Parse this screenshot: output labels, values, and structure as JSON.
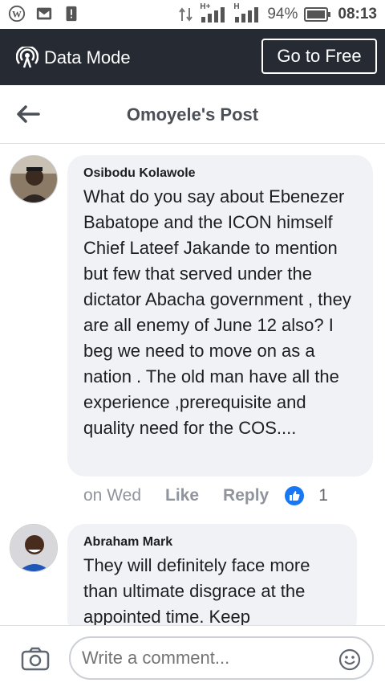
{
  "status_bar": {
    "battery": "94%",
    "time": "08:13",
    "net1": "H+",
    "net2": "H"
  },
  "data_mode": {
    "label": "Data Mode",
    "button": "Go to Free"
  },
  "header": {
    "title": "Omoyele's Post"
  },
  "comments": [
    {
      "author": "Osibodu Kolawole",
      "text": "What do you say about Ebenezer Babatope and the ICON himself Chief Lateef Jakande to mention but few that served under the dictator Abacha  government , they are all enemy of June 12 also? I beg we need to move on as a nation . The old man have all the experience ,prerequisite and quality need for the COS....",
      "time": "on Wed",
      "like_label": "Like",
      "reply_label": "Reply",
      "like_count": "1"
    },
    {
      "author": "Abraham Mark",
      "text": "They will definitely face more than ultimate disgrace at the appointed time. Keep"
    }
  ],
  "composer": {
    "placeholder": "Write a comment..."
  },
  "colors": {
    "data_bar": "#252a33",
    "bubble": "#f0f2f5",
    "like_blue": "#1877f2"
  }
}
